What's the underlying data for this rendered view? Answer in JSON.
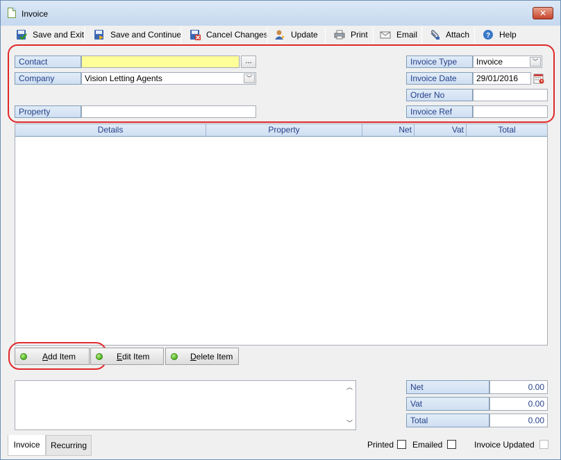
{
  "window": {
    "title": "Invoice",
    "close_glyph": "✕",
    "icon": "document-icon"
  },
  "toolbar": {
    "items": [
      {
        "label": "Save and Exit",
        "icon": "save-exit-icon"
      },
      {
        "label": "Save and Continue",
        "icon": "save-continue-icon"
      },
      {
        "label": "Cancel Changes",
        "icon": "cancel-changes-icon"
      },
      {
        "label": "Update",
        "icon": "user-update-icon"
      },
      {
        "label": "Print",
        "icon": "printer-icon"
      },
      {
        "label": "Email",
        "icon": "envelope-icon"
      },
      {
        "label": "Attach",
        "icon": "paperclip-icon"
      },
      {
        "label": "Help",
        "icon": "help-icon"
      }
    ]
  },
  "form": {
    "contact_label": "Contact",
    "contact_value": "",
    "contact_lookup": "...",
    "company_label": "Company",
    "company_value": "Vision Letting Agents",
    "property_label": "Property",
    "property_value": "",
    "invoice_type_label": "Invoice Type",
    "invoice_type_value": "Invoice",
    "invoice_date_label": "Invoice Date",
    "invoice_date_value": "29/01/2016",
    "order_no_label": "Order No",
    "order_no_value": "",
    "invoice_ref_label": "Invoice Ref",
    "invoice_ref_value": ""
  },
  "grid": {
    "columns": [
      "Details",
      "Property",
      "Net",
      "Vat",
      "Total"
    ],
    "rows": []
  },
  "item_buttons": {
    "add": {
      "prefix": "",
      "mnemonic": "A",
      "rest": "dd Item"
    },
    "edit": {
      "prefix": "",
      "mnemonic": "E",
      "rest": "dit Item"
    },
    "delete": {
      "prefix": "",
      "mnemonic": "D",
      "rest": "elete Item"
    }
  },
  "notes": {
    "value": ""
  },
  "totals": {
    "net_label": "Net",
    "net_value": "0.00",
    "vat_label": "Vat",
    "vat_value": "0.00",
    "total_label": "Total",
    "total_value": "0.00"
  },
  "tabs": [
    {
      "label": "Invoice",
      "active": true
    },
    {
      "label": "Recurring",
      "active": false
    }
  ],
  "status": {
    "printed_label": "Printed",
    "printed": false,
    "emailed_label": "Emailed",
    "emailed": false,
    "updated_label": "Invoice Updated",
    "updated": false
  },
  "colors": {
    "label_text": "#24408a",
    "highlight_outline": "#e0282a",
    "contact_field_bg": "#ffff99",
    "status_dot": "#4caf1e"
  }
}
